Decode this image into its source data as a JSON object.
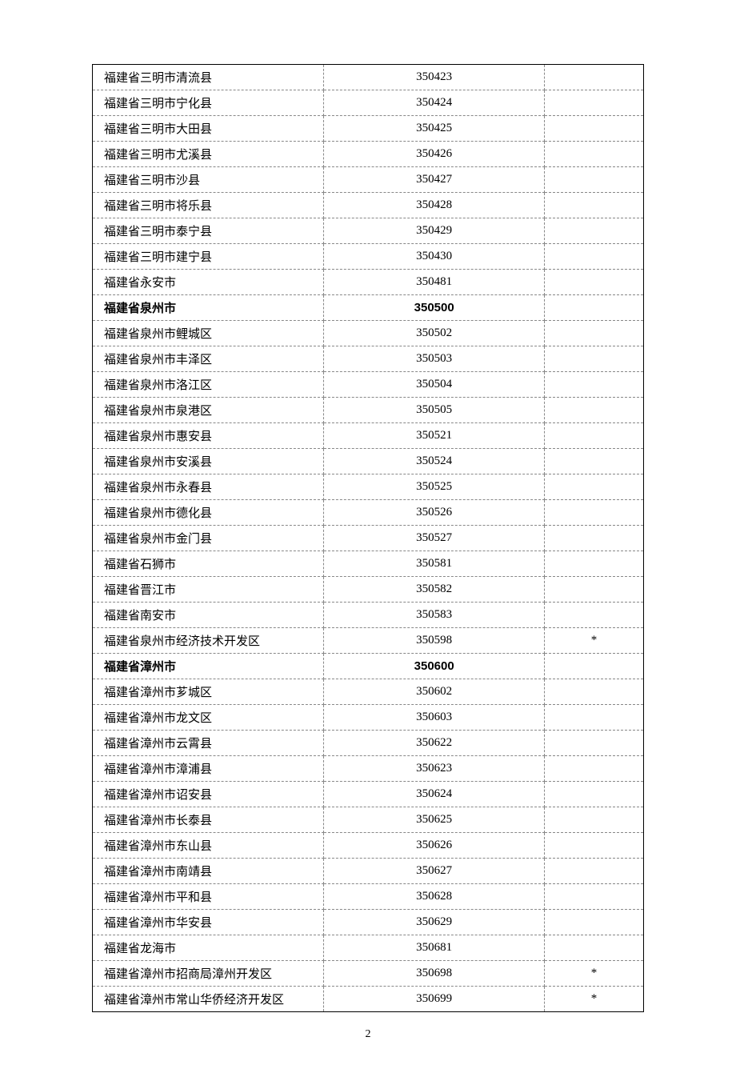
{
  "rows": [
    {
      "name": "福建省三明市清流县",
      "code": "350423",
      "mark": "",
      "bold": false
    },
    {
      "name": "福建省三明市宁化县",
      "code": "350424",
      "mark": "",
      "bold": false
    },
    {
      "name": "福建省三明市大田县",
      "code": "350425",
      "mark": "",
      "bold": false
    },
    {
      "name": "福建省三明市尤溪县",
      "code": "350426",
      "mark": "",
      "bold": false
    },
    {
      "name": "福建省三明市沙县",
      "code": "350427",
      "mark": "",
      "bold": false
    },
    {
      "name": "福建省三明市将乐县",
      "code": "350428",
      "mark": "",
      "bold": false
    },
    {
      "name": "福建省三明市泰宁县",
      "code": "350429",
      "mark": "",
      "bold": false
    },
    {
      "name": "福建省三明市建宁县",
      "code": "350430",
      "mark": "",
      "bold": false
    },
    {
      "name": "福建省永安市",
      "code": "350481",
      "mark": "",
      "bold": false
    },
    {
      "name": "福建省泉州市",
      "code": "350500",
      "mark": "",
      "bold": true
    },
    {
      "name": "福建省泉州市鲤城区",
      "code": "350502",
      "mark": "",
      "bold": false
    },
    {
      "name": "福建省泉州市丰泽区",
      "code": "350503",
      "mark": "",
      "bold": false
    },
    {
      "name": "福建省泉州市洛江区",
      "code": "350504",
      "mark": "",
      "bold": false
    },
    {
      "name": "福建省泉州市泉港区",
      "code": "350505",
      "mark": "",
      "bold": false
    },
    {
      "name": "福建省泉州市惠安县",
      "code": "350521",
      "mark": "",
      "bold": false
    },
    {
      "name": "福建省泉州市安溪县",
      "code": "350524",
      "mark": "",
      "bold": false
    },
    {
      "name": "福建省泉州市永春县",
      "code": "350525",
      "mark": "",
      "bold": false
    },
    {
      "name": "福建省泉州市德化县",
      "code": "350526",
      "mark": "",
      "bold": false
    },
    {
      "name": "福建省泉州市金门县",
      "code": "350527",
      "mark": "",
      "bold": false
    },
    {
      "name": "福建省石狮市",
      "code": "350581",
      "mark": "",
      "bold": false
    },
    {
      "name": "福建省晋江市",
      "code": "350582",
      "mark": "",
      "bold": false
    },
    {
      "name": "福建省南安市",
      "code": "350583",
      "mark": "",
      "bold": false
    },
    {
      "name": "福建省泉州市经济技术开发区",
      "code": "350598",
      "mark": "*",
      "bold": false
    },
    {
      "name": "福建省漳州市",
      "code": "350600",
      "mark": "",
      "bold": true
    },
    {
      "name": "福建省漳州市芗城区",
      "code": "350602",
      "mark": "",
      "bold": false
    },
    {
      "name": "福建省漳州市龙文区",
      "code": "350603",
      "mark": "",
      "bold": false
    },
    {
      "name": "福建省漳州市云霄县",
      "code": "350622",
      "mark": "",
      "bold": false
    },
    {
      "name": "福建省漳州市漳浦县",
      "code": "350623",
      "mark": "",
      "bold": false
    },
    {
      "name": "福建省漳州市诏安县",
      "code": "350624",
      "mark": "",
      "bold": false
    },
    {
      "name": "福建省漳州市长泰县",
      "code": "350625",
      "mark": "",
      "bold": false
    },
    {
      "name": "福建省漳州市东山县",
      "code": "350626",
      "mark": "",
      "bold": false
    },
    {
      "name": "福建省漳州市南靖县",
      "code": "350627",
      "mark": "",
      "bold": false
    },
    {
      "name": "福建省漳州市平和县",
      "code": "350628",
      "mark": "",
      "bold": false
    },
    {
      "name": "福建省漳州市华安县",
      "code": "350629",
      "mark": "",
      "bold": false
    },
    {
      "name": "福建省龙海市",
      "code": "350681",
      "mark": "",
      "bold": false
    },
    {
      "name": "福建省漳州市招商局漳州开发区",
      "code": "350698",
      "mark": "*",
      "bold": false
    },
    {
      "name": "福建省漳州市常山华侨经济开发区",
      "code": "350699",
      "mark": "*",
      "bold": false
    }
  ],
  "page_number": "2"
}
